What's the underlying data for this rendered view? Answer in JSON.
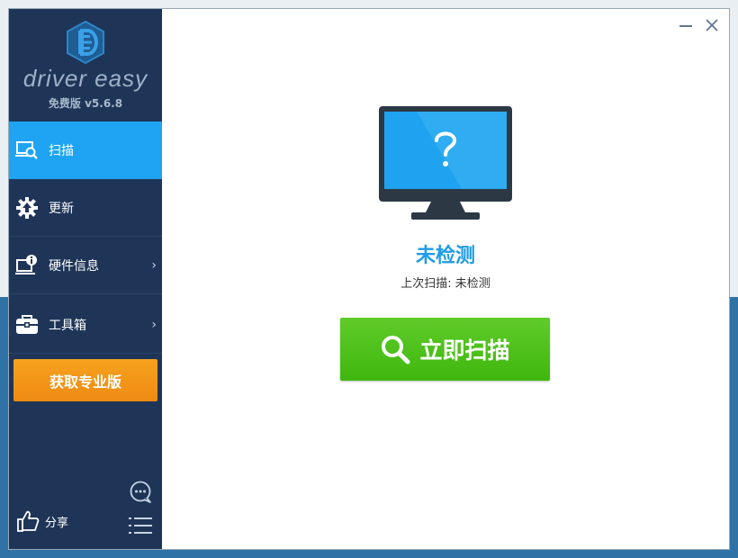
{
  "app": {
    "name": "driver easy",
    "version": "免费版 v5.6.8"
  },
  "sidebar": {
    "items": [
      {
        "label": "扫描",
        "icon": "scan-computer-icon",
        "active": true
      },
      {
        "label": "更新",
        "icon": "gear-update-icon",
        "active": false
      },
      {
        "label": "硬件信息",
        "icon": "hardware-info-icon",
        "active": false,
        "chevron": "›"
      },
      {
        "label": "工具箱",
        "icon": "toolbox-icon",
        "active": false,
        "chevron": "›"
      }
    ],
    "promo_label": "获取专业版",
    "share_label": "分享"
  },
  "main": {
    "status_title": "未检测",
    "last_scan": "上次扫描: 未检测",
    "scan_button_label": "立即扫描"
  },
  "colors": {
    "sidebar_bg": "#1e3558",
    "active_item": "#1ea4f2",
    "promo": "#f29619",
    "scan_button": "#4dbf1b",
    "status_text": "#1e9ce6"
  }
}
